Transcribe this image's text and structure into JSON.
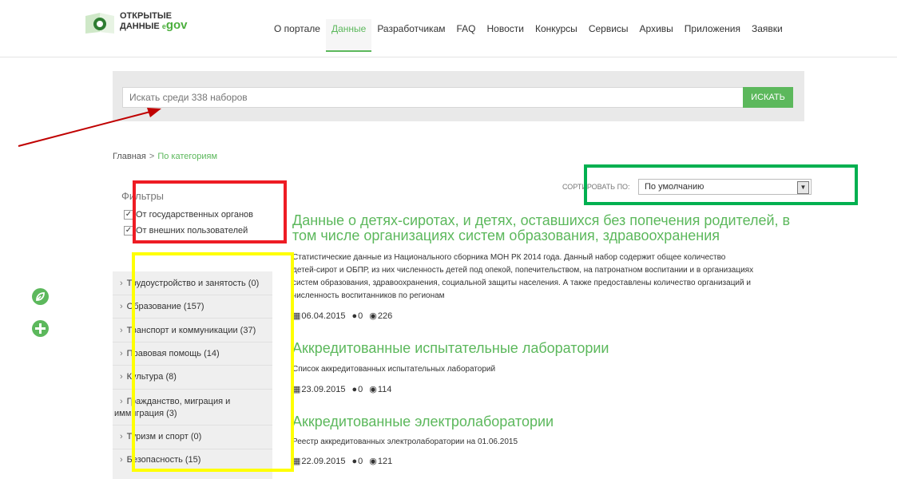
{
  "header": {
    "logo": {
      "line1": "ОТКРЫТЫЕ",
      "line2": "ДАННЫЕ",
      "e": "e",
      "gov": "gov"
    },
    "nav": [
      {
        "label": "О портале"
      },
      {
        "label": "Данные"
      },
      {
        "label": "Разработчикам"
      },
      {
        "label": "FAQ"
      },
      {
        "label": "Новости"
      },
      {
        "label": "Конкурсы"
      },
      {
        "label": "Сервисы"
      },
      {
        "label": "Архивы"
      },
      {
        "label": "Приложения"
      },
      {
        "label": "Заявки"
      }
    ],
    "active_nav": "Данные"
  },
  "search": {
    "placeholder": "Искать среди 338 наборов",
    "button_label": "ИСКАТЬ"
  },
  "breadcrumb": {
    "home": "Главная",
    "separator": ">",
    "current": "По категориям"
  },
  "filters": {
    "title": "Фильтры",
    "items": [
      {
        "label": "От государственных органов",
        "checked": true
      },
      {
        "label": "От внешних пользователей",
        "checked": true
      }
    ]
  },
  "sort": {
    "label": "СОРТИРОВАТЬ ПО:",
    "selected": "По умолчанию"
  },
  "categories": [
    {
      "label": "Трудоустройство и занятость (0)"
    },
    {
      "label": "Образование (157)"
    },
    {
      "label": "Транспорт и коммуникации (37)"
    },
    {
      "label": "Правовая помощь (14)"
    },
    {
      "label": "Культура (8)"
    },
    {
      "label": "Гражданство, миграция и",
      "label2": "иммиграция (3)"
    },
    {
      "label": "Туризм и спорт (0)"
    },
    {
      "label": "Безопасность (15)"
    }
  ],
  "datasets": [
    {
      "title_line1": "Данные о детях-сиротах, и детях, оставшихся без попечения родителей, в",
      "title_line2": "том числе организациях систем образования, здравоохранения",
      "desc_lines": [
        "Статистические данные из Национального сборника МОН РК 2014 года. Данный набор содержит общее количество",
        "детей-сирот и ОБПР, из них численность детей под опекой, попечительством, на патронатном воспитании и в организациях",
        "систем образования, здравоохранения, социальной защиты населения. А также предоставлены количество организаций и",
        "численность воспитанников по регионам"
      ],
      "date": "06.04.2015",
      "comments": "0",
      "views": "226"
    },
    {
      "title_line1": "Аккредитованные испытательные лаборатории",
      "desc_lines": [
        "Список аккредитованных испытательных лабораторий"
      ],
      "date": "23.09.2015",
      "comments": "0",
      "views": "114"
    },
    {
      "title_line1": "Аккредитованные электролаборатории",
      "desc_lines": [
        "Реестр аккредитованных электролаборатории на 01.06.2015"
      ],
      "date": "22.09.2015",
      "comments": "0",
      "views": "121"
    }
  ],
  "colors": {
    "accent": "#5cb85c",
    "annotation_red": "#ee1c24",
    "annotation_green": "#00b050",
    "annotation_yellow": "#ffff00"
  },
  "icons": {
    "side": [
      "leaf-icon",
      "plus-icon"
    ],
    "meta": [
      "calendar-icon",
      "comments-icon",
      "eye-icon"
    ]
  }
}
